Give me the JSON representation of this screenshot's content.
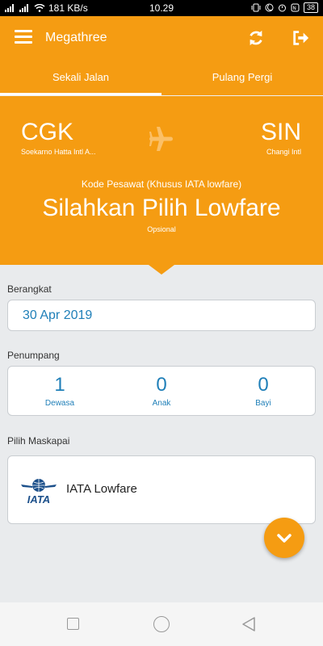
{
  "status_bar": {
    "network": "181 KB/s",
    "time": "10.29",
    "battery": "38"
  },
  "app_bar": {
    "title": "Megathree"
  },
  "tabs": [
    {
      "label": "Sekali Jalan",
      "active": true
    },
    {
      "label": "Pulang Pergi",
      "active": false
    }
  ],
  "route": {
    "from_code": "CGK",
    "from_name": "Soekarno Hatta Intl A...",
    "to_code": "SIN",
    "to_name": "Changi Intl"
  },
  "flight_code": {
    "label": "Kode Pesawat (Khusus IATA lowfare)",
    "value": "Silahkan Pilih Lowfare",
    "hint": "Opsional"
  },
  "departure": {
    "label": "Berangkat",
    "value": "30 Apr 2019"
  },
  "passengers": {
    "label": "Penumpang",
    "items": [
      {
        "count": "1",
        "label": "Dewasa"
      },
      {
        "count": "0",
        "label": "Anak"
      },
      {
        "count": "0",
        "label": "Bayi"
      }
    ]
  },
  "airline": {
    "label": "Pilih Maskapai",
    "logo_text": "IATA",
    "name": "IATA Lowfare"
  },
  "colors": {
    "primary": "#f59c12",
    "accent_text": "#1f7fb8",
    "background": "#e9ebed"
  },
  "icons": {
    "menu": "menu-icon",
    "refresh": "refresh-icon",
    "logout": "logout-icon",
    "plane": "airplane-icon",
    "fab": "chevron-down-icon"
  }
}
